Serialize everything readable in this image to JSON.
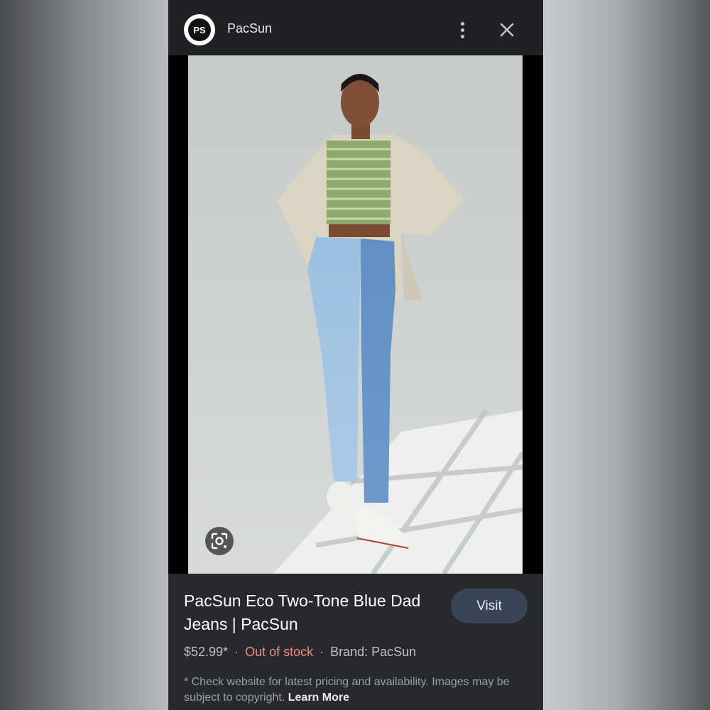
{
  "header": {
    "logo_text": "PS",
    "site_name": "PacSun"
  },
  "product": {
    "title": "PacSun Eco Two-Tone Blue Dad Jeans | PacSun",
    "price": "$52.99*",
    "stock_status": "Out of stock",
    "brand": "Brand: PacSun",
    "separator": "·",
    "visit_label": "Visit"
  },
  "disclaimer": {
    "text": "* Check website for latest pricing and availability. Images may be subject to copyright.",
    "learn_more": "Learn More"
  },
  "colors": {
    "panel_bg": "#202124",
    "info_bg": "#28292c",
    "visit_bg": "#394457",
    "out_of_stock": "#f28b82"
  },
  "icons": [
    "pacsun-logo-icon",
    "more-vert-icon",
    "close-icon",
    "lens-icon"
  ]
}
